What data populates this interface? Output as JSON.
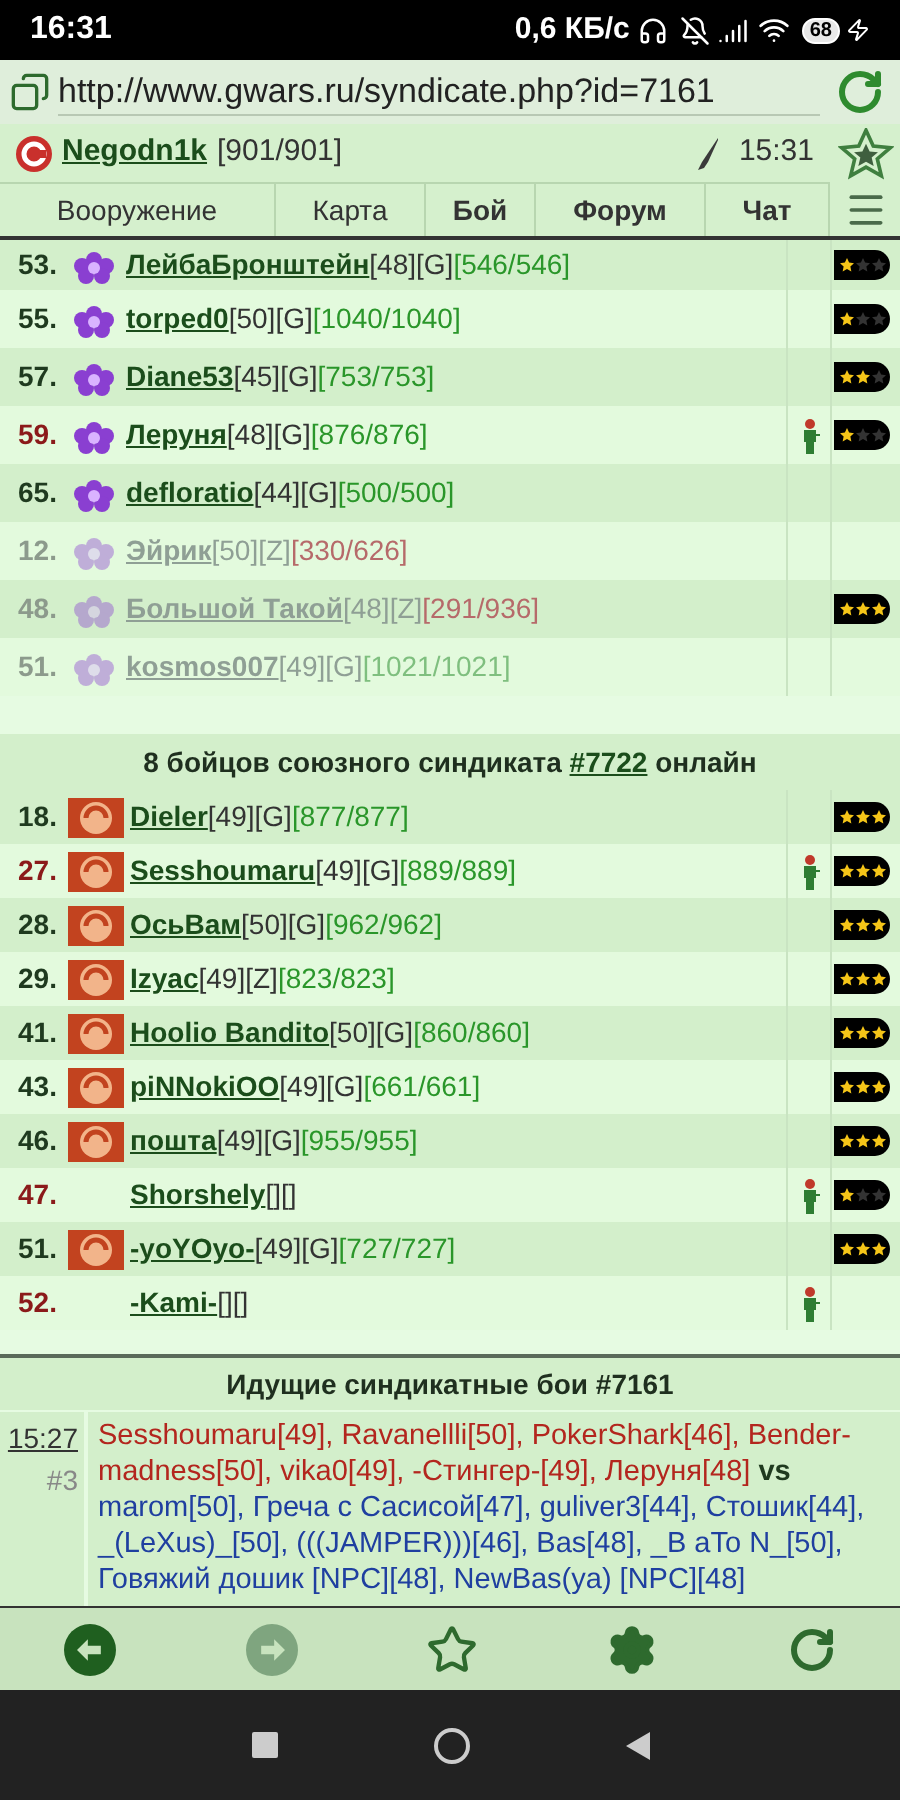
{
  "status_bar": {
    "time": "16:31",
    "speed": "0,6 КБ/с",
    "battery": "68"
  },
  "browser": {
    "url": "http://www.gwars.ru/syndicate.php?id=7161"
  },
  "header": {
    "user": "Negodn1k",
    "hp": "[901/901]",
    "time": "15:31"
  },
  "nav_tabs": [
    {
      "label": "Вооружение",
      "bold": false
    },
    {
      "label": "Карта",
      "bold": false
    },
    {
      "label": "Бой",
      "bold": true
    },
    {
      "label": "Форум",
      "bold": true
    },
    {
      "label": "Чат",
      "bold": true
    }
  ],
  "syndicate_members": [
    {
      "number": "53.",
      "alert": false,
      "dimmed": false,
      "kind": "flower",
      "name": "ЛейбаБронштейн",
      "level": "[48]",
      "clan": "[G]",
      "hp": "[546/546]",
      "injured": false,
      "in_battle": false,
      "stars": 1
    },
    {
      "number": "55.",
      "alert": false,
      "dimmed": false,
      "kind": "flower",
      "name": "torped0",
      "level": "[50]",
      "clan": "[G]",
      "hp": "[1040/1040]",
      "injured": false,
      "in_battle": false,
      "stars": 1
    },
    {
      "number": "57.",
      "alert": false,
      "dimmed": false,
      "kind": "flower",
      "name": "Diane53",
      "level": "[45]",
      "clan": "[G]",
      "hp": "[753/753]",
      "injured": false,
      "in_battle": false,
      "stars": 2
    },
    {
      "number": "59.",
      "alert": true,
      "dimmed": false,
      "kind": "flower",
      "name": "Леруня",
      "level": "[48]",
      "clan": "[G]",
      "hp": "[876/876]",
      "injured": false,
      "in_battle": true,
      "stars": 1
    },
    {
      "number": "65.",
      "alert": false,
      "dimmed": false,
      "kind": "flower",
      "name": "defloratio",
      "level": "[44]",
      "clan": "[G]",
      "hp": "[500/500]",
      "injured": false,
      "in_battle": false
    },
    {
      "number": "12.",
      "alert": false,
      "dimmed": true,
      "kind": "flower",
      "name": "Эйрик",
      "level": "[50]",
      "clan": "[Z]",
      "hp": "[330/626]",
      "injured": true,
      "in_battle": false
    },
    {
      "number": "48.",
      "alert": false,
      "dimmed": true,
      "kind": "flower",
      "name": "Большой Такой",
      "level": "[48]",
      "clan": "[Z]",
      "hp": "[291/936]",
      "injured": true,
      "in_battle": false,
      "stars": 3
    },
    {
      "number": "51.",
      "alert": false,
      "dimmed": true,
      "kind": "flower",
      "name": "kosmos007",
      "level": "[49]",
      "clan": "[G]",
      "hp": "[1021/1021]",
      "injured": false,
      "in_battle": false
    }
  ],
  "allied_section": {
    "title_before": "8 бойцов союзного синдиката",
    "link": "#7722",
    "title_after": "онлайн"
  },
  "allied_members": [
    {
      "number": "18.",
      "alert": false,
      "dimmed": false,
      "kind": "emblem",
      "name": "Dieler",
      "level": "[49]",
      "clan": "[G]",
      "hp": "[877/877]",
      "injured": false,
      "in_battle": false,
      "stars": 3
    },
    {
      "number": "27.",
      "alert": true,
      "dimmed": false,
      "kind": "emblem",
      "name": "Sesshoumaru",
      "level": "[49]",
      "clan": "[G]",
      "hp": "[889/889]",
      "injured": false,
      "in_battle": true,
      "stars": 3
    },
    {
      "number": "28.",
      "alert": false,
      "dimmed": false,
      "kind": "emblem",
      "name": "ОсьВам",
      "level": "[50]",
      "clan": "[G]",
      "hp": "[962/962]",
      "injured": false,
      "in_battle": false,
      "stars": 3
    },
    {
      "number": "29.",
      "alert": false,
      "dimmed": false,
      "kind": "emblem",
      "name": "Izyac",
      "level": "[49]",
      "clan": "[Z]",
      "hp": "[823/823]",
      "injured": false,
      "in_battle": false,
      "stars": 3
    },
    {
      "number": "41.",
      "alert": false,
      "dimmed": false,
      "kind": "emblem",
      "name": "Hoolio Bandito",
      "level": "[50]",
      "clan": "[G]",
      "hp": "[860/860]",
      "injured": false,
      "in_battle": false,
      "stars": 3
    },
    {
      "number": "43.",
      "alert": false,
      "dimmed": false,
      "kind": "emblem",
      "name": "piNNokiOO",
      "level": "[49]",
      "clan": "[G]",
      "hp": "[661/661]",
      "injured": false,
      "in_battle": false,
      "stars": 3
    },
    {
      "number": "46.",
      "alert": false,
      "dimmed": false,
      "kind": "emblem",
      "name": "пошта",
      "level": "[49]",
      "clan": "[G]",
      "hp": "[955/955]",
      "injured": false,
      "in_battle": false,
      "stars": 3
    },
    {
      "number": "47.",
      "alert": true,
      "dimmed": false,
      "kind": "plain",
      "name": "Shorshely",
      "level": "[]",
      "clan": "[]",
      "injured": false,
      "in_battle": true,
      "stars": 1
    },
    {
      "number": "51.",
      "alert": false,
      "dimmed": false,
      "kind": "emblem",
      "name": "-yoYOyo-",
      "level": "[49]",
      "clan": "[G]",
      "hp": "[727/727]",
      "injured": false,
      "in_battle": false,
      "stars": 3
    },
    {
      "number": "52.",
      "alert": true,
      "dimmed": false,
      "kind": "plain",
      "name": "-Kami-",
      "level": "[]",
      "clan": "[]",
      "injured": false,
      "in_battle": true
    }
  ],
  "battles": {
    "title": "Идущие синдикатные бои #7161",
    "items": [
      {
        "time": "15:27",
        "number": "#3",
        "team_1": "Sesshoumaru[49], Ravanellli[50], PokerShark[46], Bender-madness[50], vika0[49], -Стингер-[49], Леруня[48]",
        "versus": "vs",
        "team_2": "marom[50], Греча с Сасисой[47], guliver3[44], Стошик[44], _(LeXus)_[50], (((JAMPER)))[46], Bas[48], _B aTo N_[50], Говяжий дошик [NPC][48], NewBas(ya) [NPC][48]"
      }
    ]
  }
}
